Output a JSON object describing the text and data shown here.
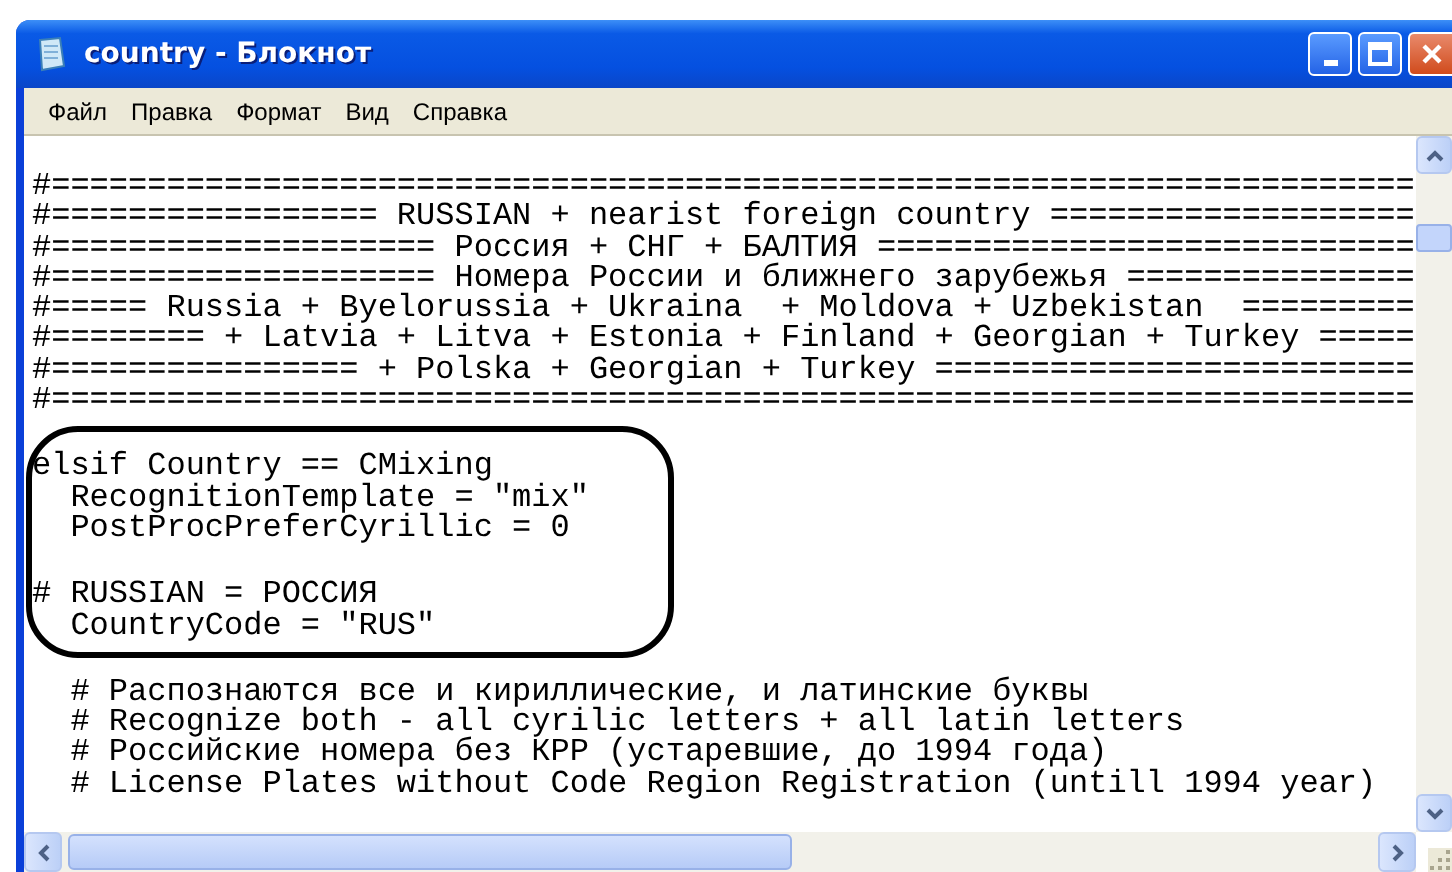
{
  "window": {
    "title": "country - Блокнот"
  },
  "menu": [
    "Файл",
    "Правка",
    "Формат",
    "Вид",
    "Справка"
  ],
  "document": {
    "lines": [
      {
        "kind": "blank"
      },
      {
        "kind": "text",
        "text": "#======================================================================="
      },
      {
        "kind": "text",
        "text": "#================= RUSSIAN + nearist foreign country ==================="
      },
      {
        "kind": "text",
        "text": "#==================== Россия + СНГ + БАЛТИЯ ============================"
      },
      {
        "kind": "text",
        "text": "#==================== Номера России и ближнего зарубежья ==============="
      },
      {
        "kind": "text",
        "text": "#===== Russia + Byelorussia + Ukraina  + Moldova + Uzbekistan  ========="
      },
      {
        "kind": "text",
        "text": "#======== + Latvia + Litva + Estonia + Finland + Georgian + Turkey ====="
      },
      {
        "kind": "text",
        "text": "#================ + Polska + Georgian + Turkey ========================="
      },
      {
        "kind": "text",
        "text": "#======================================================================="
      },
      {
        "kind": "blank"
      },
      {
        "kind": "text",
        "text": "elsif Country == CMixing"
      },
      {
        "kind": "text",
        "text": "  RecognitionTemplate = \"mix\""
      },
      {
        "kind": "text",
        "text": "  PostProcPreferCyrillic = 0"
      },
      {
        "kind": "blank"
      },
      {
        "kind": "text",
        "text": "# RUSSIAN = РОССИЯ"
      },
      {
        "kind": "text",
        "text": "  CountryCode = \"RUS\""
      },
      {
        "kind": "blank"
      },
      {
        "kind": "text",
        "text": "  # Распознаются все и кириллические, и латинские буквы"
      },
      {
        "kind": "text",
        "text": "  # Recognize both - all cyrilic letters + all latin letters"
      },
      {
        "kind": "text",
        "text": "  # Российские номера без КРР (устаревшие, до 1994 года)"
      },
      {
        "kind": "text",
        "text": "  # License Plates without Code Region Registration (untill 1994 year)"
      }
    ]
  }
}
